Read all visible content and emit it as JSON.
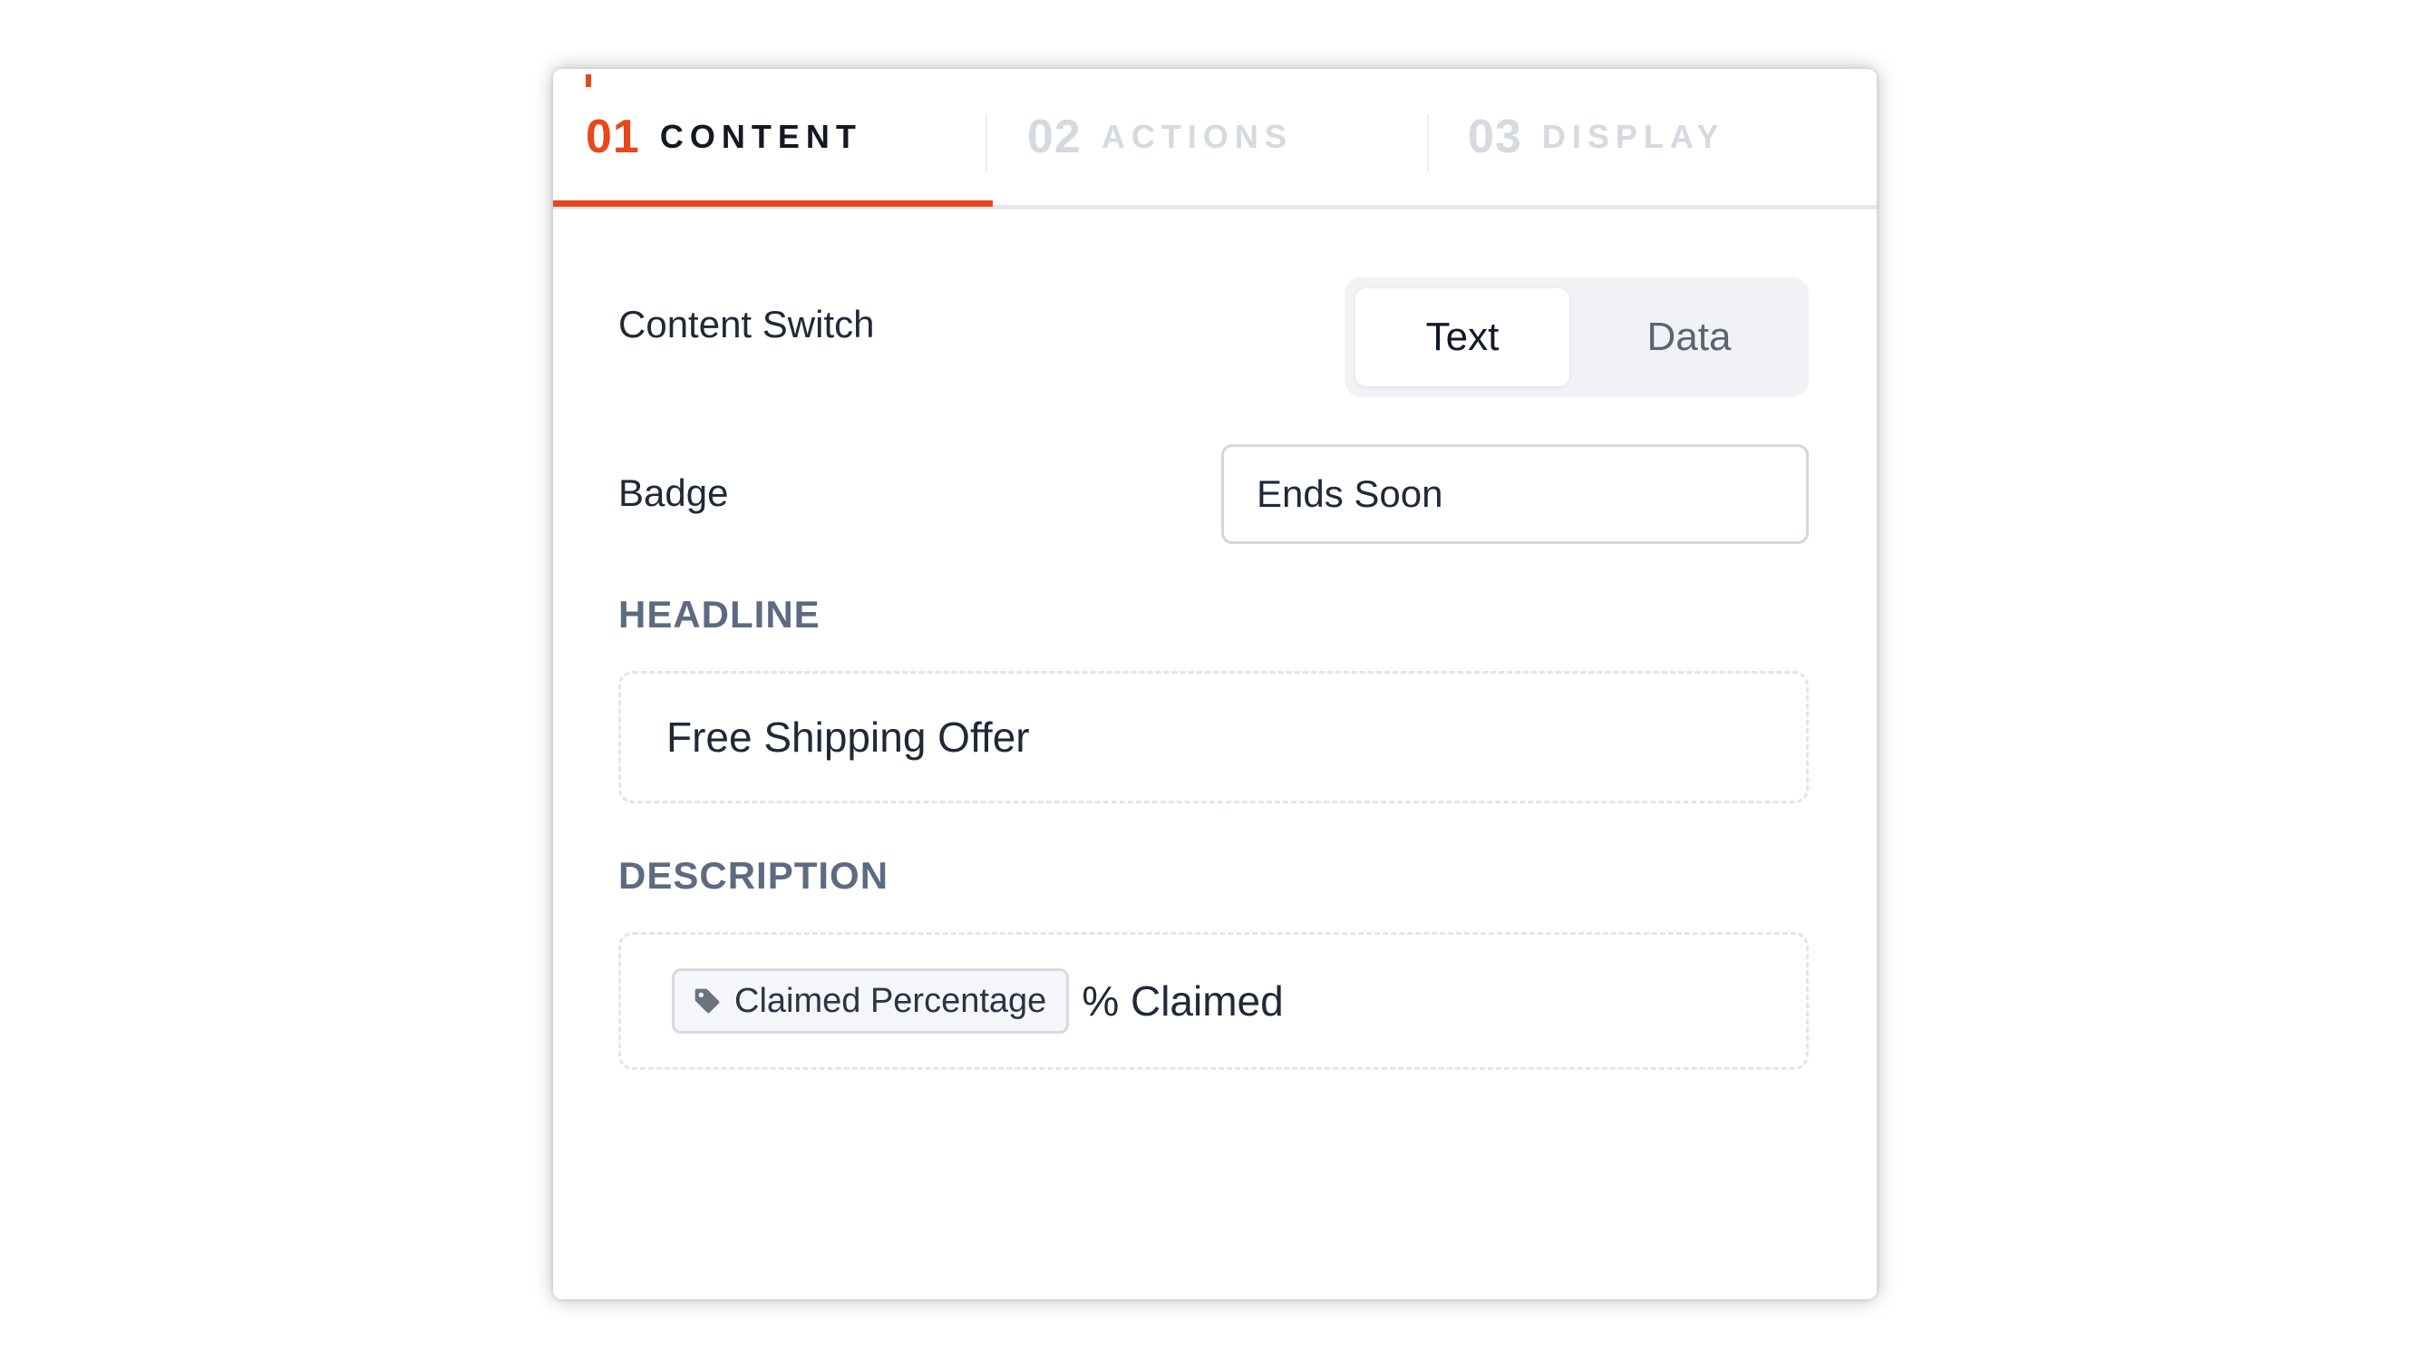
{
  "tabs": [
    {
      "number": "01",
      "label": "CONTENT",
      "active": true
    },
    {
      "number": "02",
      "label": "ACTIONS",
      "active": false
    },
    {
      "number": "03",
      "label": "DISPLAY",
      "active": false
    }
  ],
  "content_switch": {
    "label": "Content Switch",
    "options": [
      "Text",
      "Data"
    ],
    "selected": "Text"
  },
  "badge": {
    "label": "Badge",
    "value": "Ends Soon"
  },
  "headline": {
    "heading": "HEADLINE",
    "value": "Free Shipping Offer"
  },
  "description": {
    "heading": "DESCRIPTION",
    "token": {
      "label": "Claimed Percentage",
      "icon": "tag-icon"
    },
    "suffix": "% Claimed"
  },
  "colors": {
    "accent": "#e8471c",
    "heading": "#5d6b82",
    "text": "#1f2937"
  }
}
